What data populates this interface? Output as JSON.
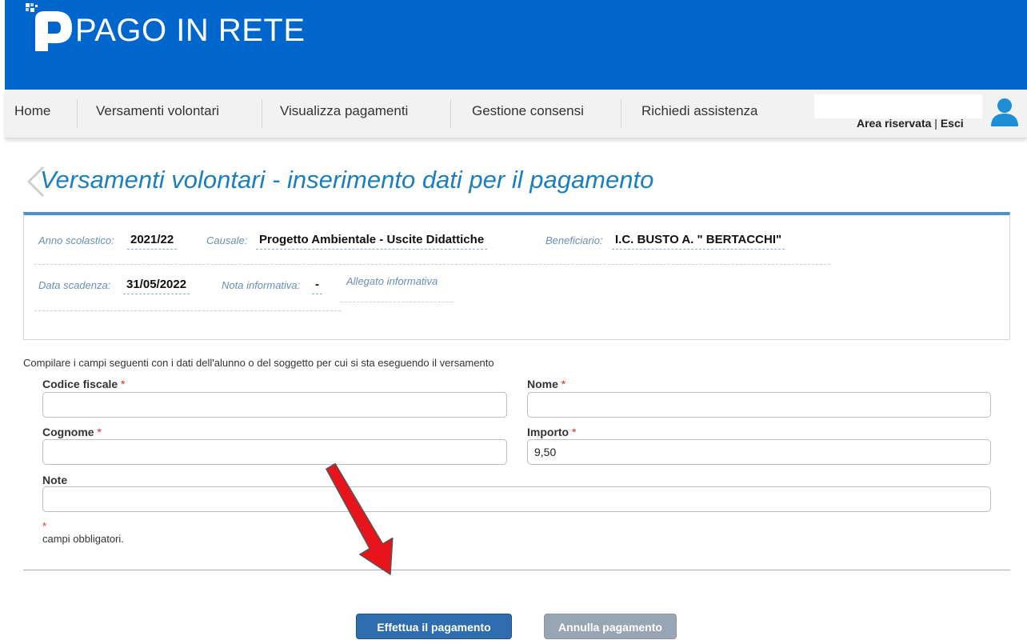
{
  "header": {
    "brand": "PAGO IN RETE"
  },
  "nav": {
    "items": [
      "Home",
      "Versamenti volontari",
      "Visualizza pagamenti",
      "Gestione consensi",
      "Richiedi assistenza"
    ],
    "area_riservata": "Area riservata",
    "separator": "|",
    "esci": "Esci"
  },
  "page": {
    "title": "Versamenti volontari - inserimento dati per il pagamento"
  },
  "info": {
    "anno_label": "Anno scolastico:",
    "anno_value": "2021/22",
    "causale_label": "Causale:",
    "causale_value": "Progetto Ambientale - Uscite Didattiche",
    "beneficiario_label": "Beneficiario:",
    "beneficiario_value": "I.C. BUSTO A. \" BERTACCHI\"",
    "scadenza_label": "Data scadenza:",
    "scadenza_value": "31/05/2022",
    "nota_label": "Nota informativa:",
    "nota_value": "-",
    "allegato_label": "Allegato informativa"
  },
  "form": {
    "intro": "Compilare i campi seguenti con i dati dell'alunno o del soggetto per cui si sta eseguendo il versamento",
    "required_mark": "*",
    "codice_fiscale_label": "Codice fiscale",
    "codice_fiscale_value": "",
    "nome_label": "Nome",
    "nome_value": "",
    "cognome_label": "Cognome",
    "cognome_value": "",
    "importo_label": "Importo",
    "importo_value": "9,50",
    "note_label": "Note",
    "note_value": "",
    "mandatory_note": "campi obbligatori."
  },
  "buttons": {
    "pay": "Effettua il pagamento",
    "cancel": "Annulla pagamento"
  },
  "colors": {
    "brand_blue": "#0066cc",
    "title_blue": "#1b7ec0",
    "required_red": "#e4281e",
    "pay_button": "#2f6cb0",
    "cancel_button": "#98a6b4",
    "arrow_red": "#e8141b"
  },
  "icons": {
    "logo": "pagopa-logo-icon",
    "user": "user-icon",
    "title_deco": "chevron-decoration-icon",
    "annotation": "red-arrow-annotation"
  }
}
